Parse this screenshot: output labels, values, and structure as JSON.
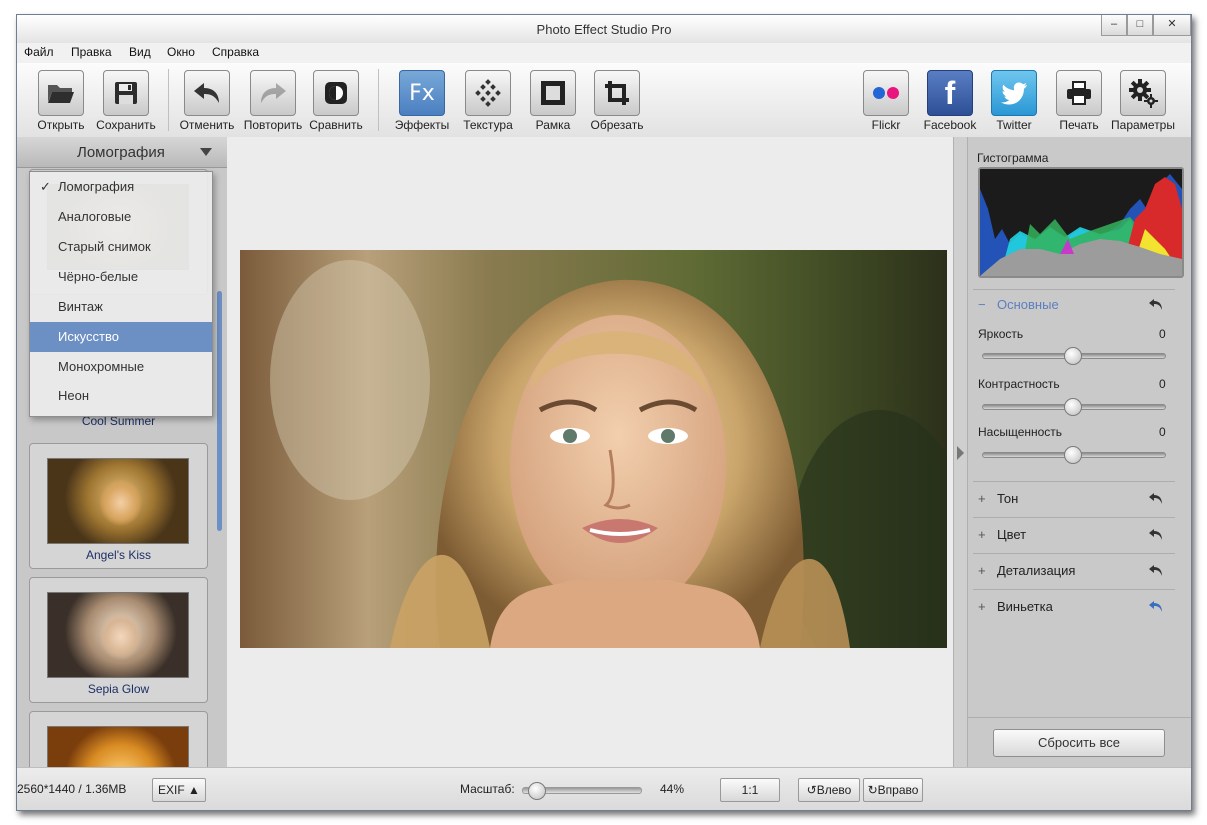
{
  "window": {
    "title": "Photo Effect Studio Pro",
    "controls": {
      "minimize": "–",
      "maximize": "□",
      "close": "✕"
    }
  },
  "menu": [
    {
      "label": "Файл"
    },
    {
      "label": "Правка"
    },
    {
      "label": "Вид"
    },
    {
      "label": "Окно"
    },
    {
      "label": "Справка"
    }
  ],
  "toolbar": {
    "left": [
      {
        "label": "Открыть",
        "icon": "folder-icon"
      },
      {
        "label": "Сохранить",
        "icon": "floppy-icon"
      },
      {
        "label": "Отменить",
        "icon": "undo-arrow-icon"
      },
      {
        "label": "Повторить",
        "icon": "redo-arrow-icon"
      },
      {
        "label": "Сравнить",
        "icon": "compare-icon"
      },
      {
        "label": "Эффекты",
        "icon": "fx-icon"
      },
      {
        "label": "Текстура",
        "icon": "texture-icon"
      },
      {
        "label": "Рамка",
        "icon": "frame-icon"
      },
      {
        "label": "Обрезать",
        "icon": "crop-icon"
      }
    ],
    "right": [
      {
        "label": "Flickr",
        "icon": "flickr-icon"
      },
      {
        "label": "Facebook",
        "icon": "facebook-icon"
      },
      {
        "label": "Twitter",
        "icon": "twitter-icon"
      },
      {
        "label": "Печать",
        "icon": "printer-icon"
      },
      {
        "label": "Параметры",
        "icon": "settings-gear-icon"
      }
    ],
    "fx_glyph": "Fx",
    "facebook_glyph": "f"
  },
  "effects_panel": {
    "category": "Ломография",
    "dropdown": [
      {
        "label": "Ломография",
        "checked": true
      },
      {
        "label": "Аналоговые"
      },
      {
        "label": "Старый снимок"
      },
      {
        "label": "Чёрно-белые"
      },
      {
        "label": "Винтаж"
      },
      {
        "label": "Искусство",
        "selected": true
      },
      {
        "label": "Монохромные"
      },
      {
        "label": "Неон"
      }
    ],
    "check_mark": "✓",
    "effects": [
      {
        "name": "Cool Summer"
      },
      {
        "name": "Angel's Kiss"
      },
      {
        "name": "Sepia Glow"
      }
    ]
  },
  "adjustments": {
    "histogram_label": "Гистограмма",
    "basic": {
      "title": "Основные",
      "toggle": "−",
      "sliders": [
        {
          "label": "Яркость",
          "value": "0"
        },
        {
          "label": "Контрастность",
          "value": "0"
        },
        {
          "label": "Насыщенность",
          "value": "0"
        }
      ]
    },
    "sections": [
      {
        "title": "Тон",
        "toggle": "+"
      },
      {
        "title": "Цвет",
        "toggle": "+"
      },
      {
        "title": "Детализация",
        "toggle": "+"
      },
      {
        "title": "Виньетка",
        "toggle": "+"
      }
    ],
    "reset_label": "Сбросить все"
  },
  "status": {
    "image_info": "2560*1440 / 1.36MB",
    "exif_label": "EXIF ▲",
    "zoom_label": "Масштаб:",
    "zoom_value": "44%",
    "zoom_fraction": 0.05,
    "actual_size_label": "1:1",
    "rotate_left_label": "Влево",
    "rotate_right_label": "Вправо"
  },
  "colors": {
    "accent": "#6c8fc4",
    "section_accent": "#5b7fc0"
  }
}
